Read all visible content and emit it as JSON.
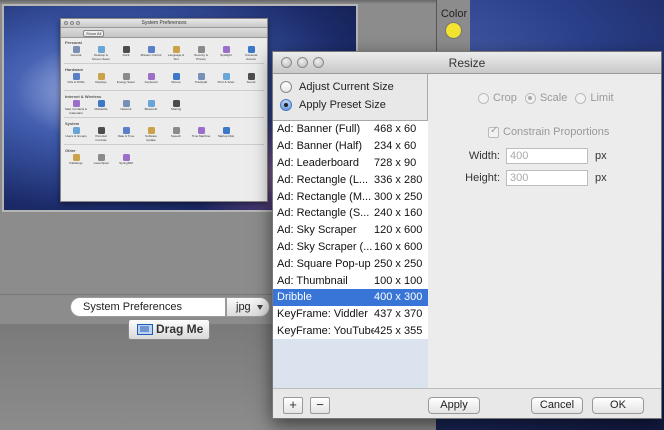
{
  "background_app": {
    "color_label": "Color",
    "swatch_color": "#f3e431",
    "filename": "System Preferences",
    "format": "jpg",
    "drag_label": "Drag Me"
  },
  "preview": {
    "window_title": "System Preferences",
    "show_all": "Show All",
    "sections": [
      {
        "title": "Personal",
        "items": [
          "General",
          "Desktop & Screen Saver",
          "Dock",
          "Mission Control",
          "Language & Text",
          "Security & Privacy",
          "Spotlight",
          "Universal Access"
        ]
      },
      {
        "title": "Hardware",
        "items": [
          "CDs & DVDs",
          "Displays",
          "Energy Saver",
          "Keyboard",
          "Mouse",
          "Trackpad",
          "Print & Scan",
          "Sound"
        ]
      },
      {
        "title": "Internet & Wireless",
        "items": [
          "Mail, Contacts & Calendars",
          "MobileMe",
          "Network",
          "Bluetooth",
          "Sharing"
        ]
      },
      {
        "title": "System",
        "items": [
          "Users & Groups",
          "Parental Controls",
          "Date & Time",
          "Software Update",
          "Speech",
          "Time Machine",
          "Startup Disk"
        ]
      },
      {
        "title": "Other",
        "items": [
          "FileMerge",
          "Launchpad",
          "SpringMM"
        ]
      }
    ]
  },
  "dialog": {
    "title": "Resize",
    "mode_options": [
      "Adjust Current Size",
      "Apply Preset Size"
    ],
    "presets": [
      {
        "name": "Ad: Banner (Full)",
        "size": "468 x 60"
      },
      {
        "name": "Ad: Banner (Half)",
        "size": "234 x 60"
      },
      {
        "name": "Ad: Leaderboard",
        "size": "728 x 90"
      },
      {
        "name": "Ad: Rectangle (L...",
        "size": "336 x 280"
      },
      {
        "name": "Ad: Rectangle (M...",
        "size": "300 x 250"
      },
      {
        "name": "Ad: Rectangle (S...",
        "size": "240 x 160"
      },
      {
        "name": "Ad: Sky Scraper",
        "size": "120 x 600"
      },
      {
        "name": "Ad: Sky Scraper (...",
        "size": "160 x 600"
      },
      {
        "name": "Ad: Square Pop-up",
        "size": "250 x 250"
      },
      {
        "name": "Ad: Thumbnail",
        "size": "100 x 100"
      },
      {
        "name": "Dribble",
        "size": "400 x 300"
      },
      {
        "name": "KeyFrame: Viddler",
        "size": "437 x 370"
      },
      {
        "name": "KeyFrame: YouTube",
        "size": "425 x 355"
      }
    ],
    "selected_preset": "Dribble",
    "scale_options": [
      "Crop",
      "Scale",
      "Limit"
    ],
    "constrain_label": "Constrain Proportions",
    "width_label": "Width:",
    "width_value": "400",
    "height_label": "Height:",
    "height_value": "300",
    "unit": "px",
    "add_label": "+",
    "remove_label": "−",
    "apply_label": "Apply",
    "cancel_label": "Cancel",
    "ok_label": "OK"
  }
}
